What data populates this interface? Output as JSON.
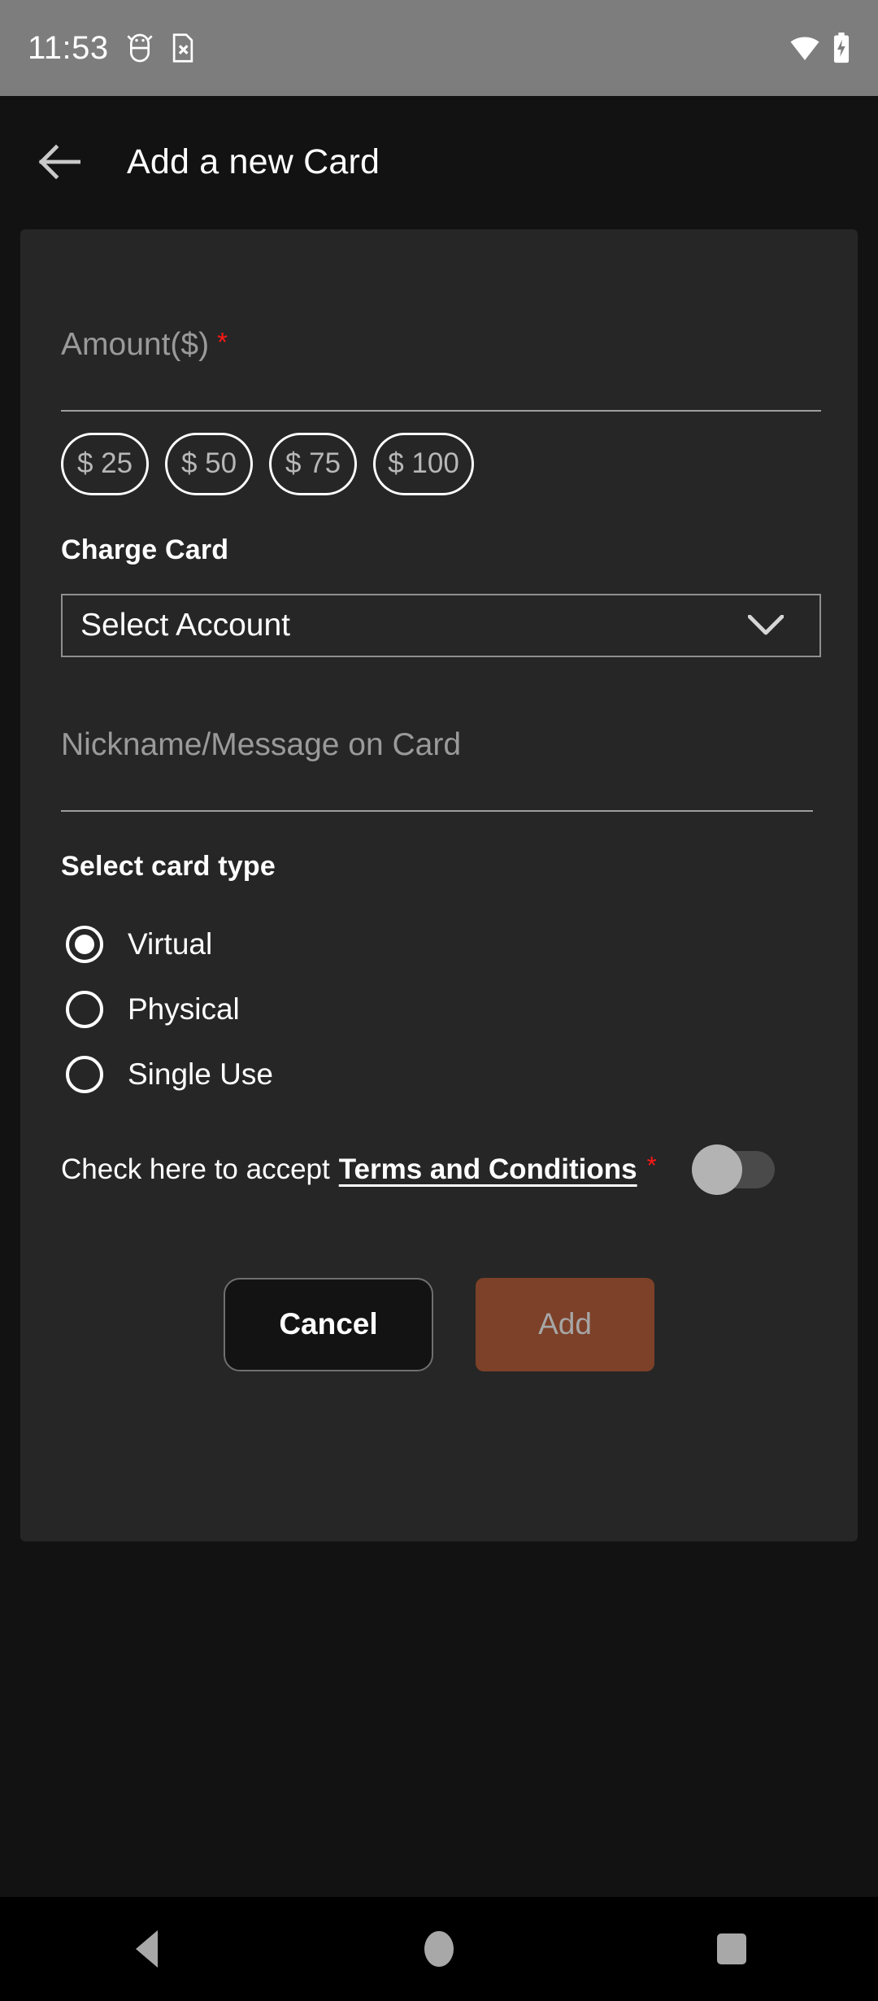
{
  "status_bar": {
    "time": "11:53",
    "icons_left": [
      "android-debug-icon",
      "sim-card-missing-icon"
    ],
    "icons_right": [
      "wifi-icon",
      "battery-charging-icon"
    ],
    "background": "#7d7d7d"
  },
  "app_bar": {
    "back_icon": "back-arrow-icon",
    "title": "Add a new Card"
  },
  "form": {
    "amount": {
      "label": "Amount($)",
      "required_mark": "*",
      "value": "",
      "placeholder": ""
    },
    "amount_chips": [
      {
        "label": "$ 25"
      },
      {
        "label": "$ 50"
      },
      {
        "label": "$ 75"
      },
      {
        "label": "$ 100"
      }
    ],
    "charge_card": {
      "label": "Charge Card",
      "selected": "Select Account",
      "chevron_icon": "chevron-down-icon"
    },
    "nickname": {
      "placeholder": "Nickname/Message on Card",
      "value": ""
    },
    "card_type": {
      "label": "Select card type",
      "selected": "Virtual",
      "options": [
        {
          "label": "Virtual",
          "selected": true
        },
        {
          "label": "Physical",
          "selected": false
        },
        {
          "label": "Single Use",
          "selected": false
        }
      ]
    },
    "terms": {
      "prefix": "Check here to accept",
      "link": "Terms and Conditions",
      "required_mark": "*",
      "toggle_state": "off"
    },
    "actions": {
      "cancel_label": "Cancel",
      "add_label": "Add",
      "add_enabled": false,
      "add_color": "#7d4028"
    }
  },
  "nav_bar": {
    "back": "nav-back-icon",
    "home": "nav-home-icon",
    "recents": "nav-recents-icon"
  },
  "theme": {
    "page_background": "#121212",
    "panel_background": "#262626",
    "accent": "#7d4028",
    "required_star": "#ff1717"
  }
}
